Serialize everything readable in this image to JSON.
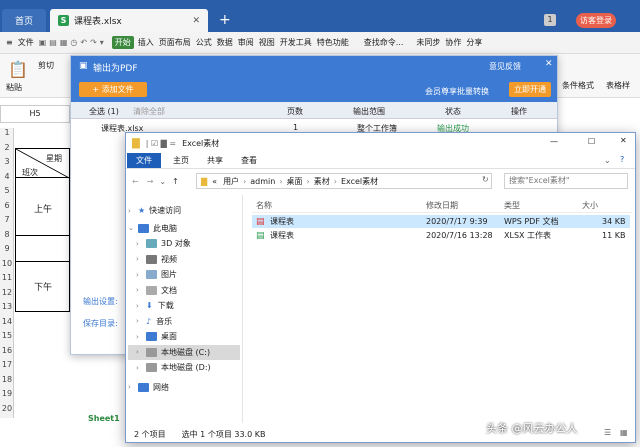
{
  "wps": {
    "tab_home": "首页",
    "tab_doc": "课程表.xlsx",
    "badge": "1",
    "login": "访客登录",
    "menu": [
      "文件",
      "开始",
      "插入",
      "页面布局",
      "公式",
      "数据",
      "审阅",
      "视图",
      "开发工具",
      "特色功能",
      "查找命令...",
      "未同步",
      "协作",
      "分享"
    ],
    "ribbon_left": [
      "剪切",
      "粘贴"
    ],
    "ribbon_right": [
      "条件格式",
      "表格样"
    ],
    "namebox": "H5",
    "sheet_tab": "Sheet1",
    "table": {
      "star": "星期",
      "class": "班次",
      "am": "上午",
      "pm": "下午"
    },
    "row_nums": [
      "1",
      "2",
      "3",
      "4",
      "5",
      "6",
      "7",
      "8",
      "9",
      "10",
      "11",
      "12",
      "13",
      "14",
      "15",
      "16",
      "17",
      "18",
      "19",
      "20"
    ]
  },
  "pdf": {
    "title": "输出为PDF",
    "feedback": "意见反馈",
    "add_file": "+ 添加文件",
    "vip": "会员尊享批量转换",
    "open_btn": "立即开通",
    "cols": [
      "全选 (1)",
      "清除全部",
      "页数",
      "输出范围",
      "状态",
      "操作"
    ],
    "row": [
      "课程表.xlsx",
      "1",
      "整个工作簿",
      "输出成功"
    ],
    "settings_label": "输出设置:",
    "save_label": "保存目录:"
  },
  "explorer": {
    "title": "Excel素材",
    "ribbon_tabs": [
      "文件",
      "主页",
      "共享",
      "查看"
    ],
    "path": [
      "«",
      "用户",
      "admin",
      "桌面",
      "素材",
      "Excel素材"
    ],
    "search_placeholder": "搜索\"Excel素材\"",
    "cols": [
      "名称",
      "修改日期",
      "类型",
      "大小"
    ],
    "files": [
      {
        "name": "课程表",
        "date": "2020/7/17 9:39",
        "type": "WPS PDF 文档",
        "size": "34 KB"
      },
      {
        "name": "课程表",
        "date": "2020/7/16 13:28",
        "type": "XLSX 工作表",
        "size": "11 KB"
      }
    ],
    "nav": [
      "快速访问",
      "此电脑",
      "3D 对象",
      "视频",
      "图片",
      "文档",
      "下载",
      "音乐",
      "桌面",
      "本地磁盘 (C:)",
      "本地磁盘 (D:)",
      "网络"
    ],
    "status": [
      "2 个项目",
      "选中 1 个项目  33.0 KB"
    ]
  },
  "watermark": "头条 @风云办公人"
}
